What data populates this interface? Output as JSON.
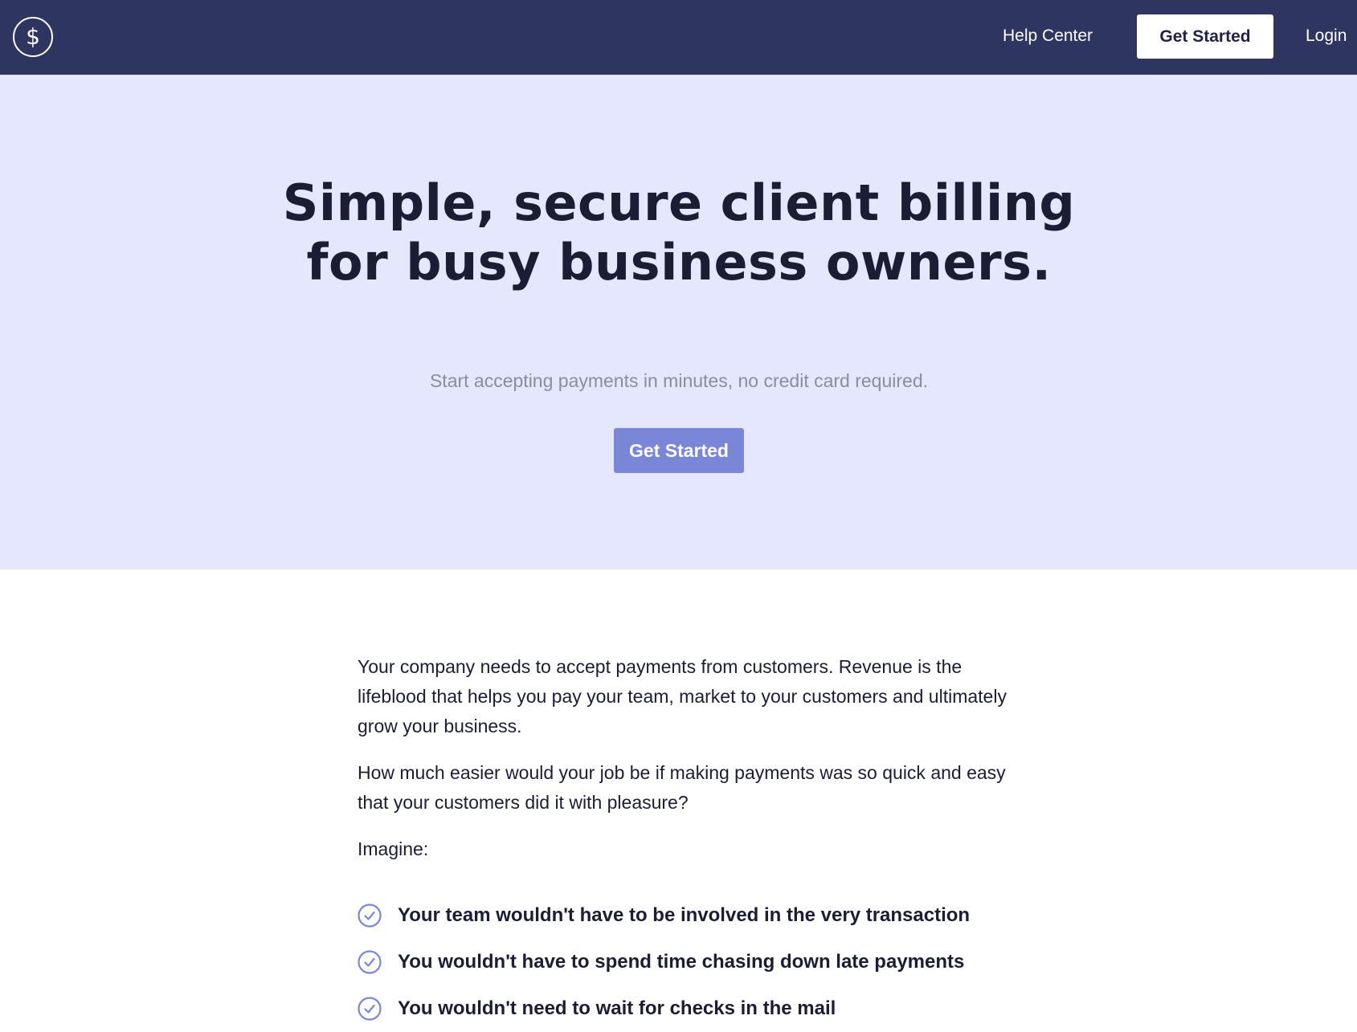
{
  "navbar": {
    "logo_icon": "dollar-circle-icon",
    "help_label": "Help Center",
    "cta_label": "Get Started",
    "login_label": "Login"
  },
  "hero": {
    "title": "Simple, secure client billing for busy business owners.",
    "subtitle": "Start accepting payments in minutes, no credit card required.",
    "cta_label": "Get Started"
  },
  "content": {
    "paragraphs": [
      "Your company needs to accept payments from customers. Revenue is the lifeblood that helps you pay your team, market to your customers and ultimately grow your business.",
      "How much easier would your job be if making payments was so quick and easy that your customers did it with pleasure?",
      "Imagine:"
    ],
    "benefits": [
      "Your team wouldn't have to be involved in the very transaction",
      "You wouldn't have to spend time chasing down late payments",
      "You wouldn't need to wait for checks in the mail"
    ],
    "benefit_icon": "check-circle-icon"
  },
  "colors": {
    "navbar_bg": "#2f3561",
    "hero_bg": "#e5e7fe",
    "accent": "#7a86d8",
    "text_dark": "#1b1d36",
    "text_muted": "#8a8d9e"
  }
}
